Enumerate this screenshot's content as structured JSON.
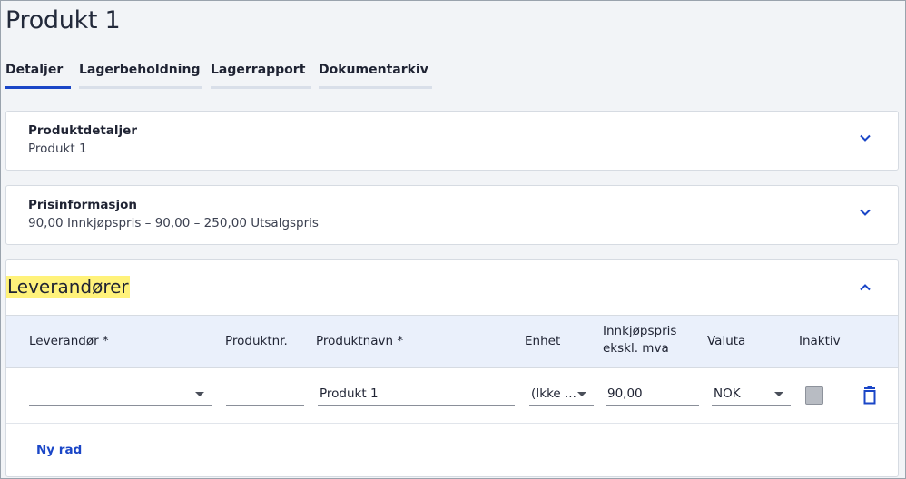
{
  "page": {
    "title": "Produkt 1"
  },
  "tabs": [
    {
      "label": "Detaljer",
      "active": true
    },
    {
      "label": "Lagerbeholdning",
      "active": false
    },
    {
      "label": "Lagerrapport",
      "active": false
    },
    {
      "label": "Dokumentarkiv",
      "active": false
    }
  ],
  "product_details": {
    "title": "Produktdetaljer",
    "subtitle": "Produkt 1",
    "icon": "chevron-down-icon"
  },
  "price_info": {
    "title": "Prisinformasjon",
    "subtitle": "90,00 Innkjøpspris  –  90,00  –  250,00 Utsalgspris",
    "icon": "chevron-down-icon"
  },
  "suppliers": {
    "title": "Leverandører",
    "icon": "chevron-up-icon",
    "columns": {
      "supplier": "Leverandør *",
      "product_no": "Produktnr.",
      "product_name": "Produktnavn *",
      "unit": "Enhet",
      "purchase_price_line1": "Innkjøpspris",
      "purchase_price_line2": "ekskl. mva",
      "currency": "Valuta",
      "inactive": "Inaktiv"
    },
    "rows": [
      {
        "supplier": "",
        "product_no": "",
        "product_name": "Produkt 1",
        "unit": "(Ikke ...",
        "purchase_price": "90,00",
        "currency": "NOK",
        "inactive": true
      }
    ],
    "add_row_label": "Ny rad"
  },
  "colors": {
    "accent": "#1a46c7",
    "highlight": "#fff27a",
    "header_bg": "#eaf0fb"
  }
}
